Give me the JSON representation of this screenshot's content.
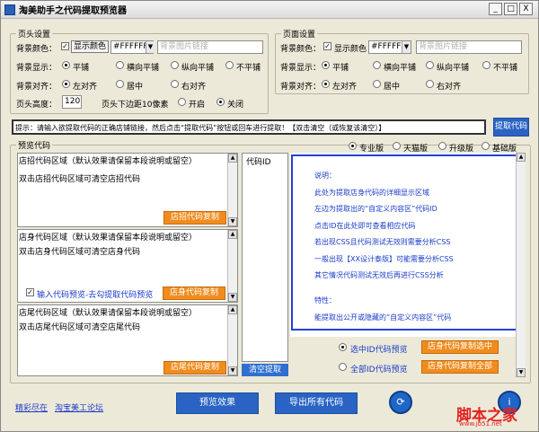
{
  "window": {
    "title": "淘美助手之代码提取预览器",
    "buttons": [
      "_",
      "□",
      "X"
    ]
  },
  "header_settings": {
    "group_title": "页头设置",
    "bg_color_label": "背景颜色：",
    "show_color_label": "显示颜色",
    "color_value": "#FFFFFF",
    "bg_image_placeholder": "背景图片链接",
    "bg_display_label": "背景显示：",
    "display_options": [
      "平铺",
      "横向平铺",
      "纵向平铺",
      "不平铺"
    ],
    "bg_align_label": "背景对齐：",
    "align_options": [
      "左对齐",
      "居中",
      "右对齐"
    ],
    "height_label": "页头高度：",
    "height_value": "120",
    "margin_label": "页头下边距10像素",
    "margin_options": [
      "开启",
      "关闭"
    ]
  },
  "page_settings": {
    "group_title": "页面设置",
    "bg_color_label": "背景颜色：",
    "show_color_label": "显示颜色",
    "color_value": "#FFFFFF",
    "bg_image_placeholder": "背景图片链接",
    "bg_display_label": "背景显示：",
    "display_options": [
      "平铺",
      "横向平铺",
      "纵向平铺",
      "不平铺"
    ],
    "bg_align_label": "背景对齐：",
    "align_options": [
      "左对齐",
      "居中",
      "右对齐"
    ]
  },
  "prompt": {
    "text": "提示：请输入欲提取代码的正确店铺链接，然后点击“提取代码”按钮或回车进行提取！【双击清空（或恢复该清空）】",
    "extract_button": "提取代码"
  },
  "preview": {
    "group_title": "预览代码",
    "versions": [
      "专业版",
      "天猫版",
      "升级版",
      "基础版"
    ],
    "recruit_header": "店招代码区域（默认效果请保留本段说明或留空）",
    "recruit_hint": "双击店招代码区域可清空店招代码",
    "recruit_copy": "店招代码复制",
    "body_header": "店身代码区域（默认效果请保留本段说明或留空）",
    "body_hint": "双击店身代码区域可清空店身代码",
    "input_preview_label": "输入代码预览-去勾提取代码预览",
    "body_copy": "店身代码复制",
    "tail_header": "店尾代码区域（默认效果请保留本段说明或留空）",
    "tail_hint": "双击店尾代码区域可清空店尾代码",
    "tail_copy": "店尾代码复制",
    "code_id_label": "代码ID",
    "clear_extract": "清空提取",
    "info_lines": [
      "说明：",
      "此处为提取店身代码的详细显示区域",
      "左边为提取出的“自定义内容区”代码ID",
      "点击ID在此处即可查看相应代码",
      "若出现CSS且代码测试无效则需要分析CSS",
      "一般出现【XX设计泰版】可能需要分析CSS",
      "其它情况代码测试无效后再进行CSS分析",
      "",
      "特性：",
      "能提取出公开或隐藏的“自定义内容区”代码"
    ],
    "selected_preview": "选中ID代码预览",
    "all_preview": "全部ID代码预览",
    "copy_selected": "店身代码复制选中",
    "copy_all": "店身代码复制全部"
  },
  "footer": {
    "link1": "精彩尽在",
    "link2": "淘宝美工论坛",
    "preview_button": "预览效果",
    "export_button": "导出所有代码",
    "watermark": "脚本之家",
    "watermark_url": "www.jb51.net"
  }
}
